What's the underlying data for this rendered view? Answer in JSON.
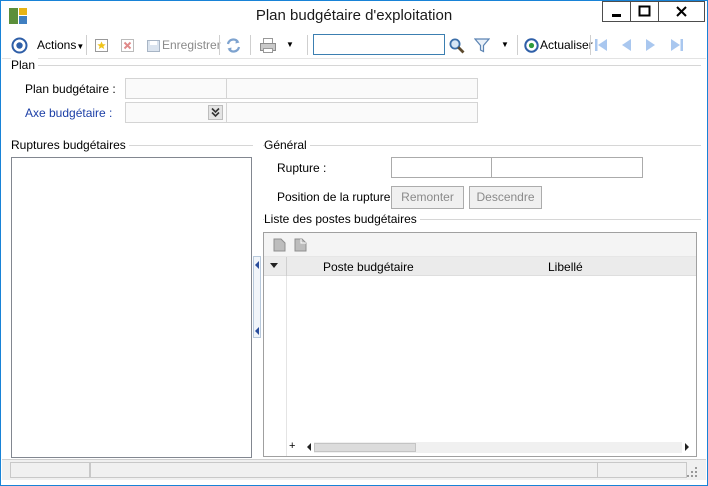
{
  "window": {
    "title": "Plan budgétaire d'exploitation",
    "controls": {
      "minimize": "—",
      "maximize": "☐",
      "close": "✕"
    }
  },
  "toolbar": {
    "actions_label": "Actions",
    "save_label": "Enregistrer",
    "refresh_label": "Actualiser",
    "search": {
      "value": "",
      "placeholder": ""
    }
  },
  "plan": {
    "group_label": "Plan",
    "plan_budgetaire_label": "Plan budgétaire :",
    "axe_budgetaire_label": "Axe budgétaire :",
    "plan_code": "",
    "plan_desc": "",
    "axe_code": "",
    "axe_desc": ""
  },
  "ruptures": {
    "group_label": "Ruptures budgétaires",
    "items": []
  },
  "general": {
    "group_label": "Général",
    "rupture_label": "Rupture :",
    "rupture_value1": "",
    "rupture_value2": "",
    "position_label": "Position de la rupture :",
    "move_up_label": "Remonter",
    "move_down_label": "Descendre"
  },
  "postes": {
    "group_label": "Liste des postes budgétaires",
    "columns": [
      "Poste budgétaire",
      "Libellé"
    ],
    "rows": [],
    "add_symbol": "+"
  },
  "colors": {
    "window_border": "#1883d7",
    "label_blue": "#1c3fa6",
    "nav_blue": "#a9c7ef"
  }
}
